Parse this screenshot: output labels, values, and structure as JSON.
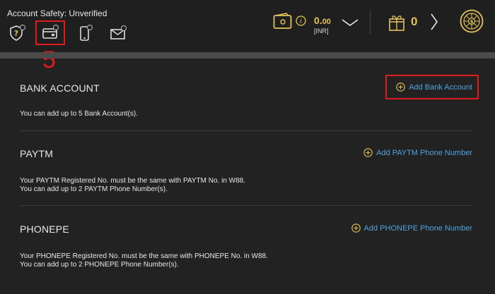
{
  "header": {
    "account_safety": "Account Safety: Unverified",
    "balance_main": "0.",
    "balance_decimals": "00",
    "currency": "[INR]",
    "gift_count": "0",
    "step_number": "5"
  },
  "icons": [
    "shield-question-icon",
    "card-icon",
    "phone-icon",
    "mail-icon",
    "wallet-icon",
    "info-icon",
    "chevron-down-icon",
    "gift-icon",
    "chevron-right-icon",
    "lucky-wheel-icon",
    "plus-circle-icon"
  ],
  "colors": {
    "accent_gold": "#e3c25a",
    "link_blue": "#4fa3e0",
    "highlight_red": "#e01b1b"
  },
  "sections": {
    "bank": {
      "title": "BANK ACCOUNT",
      "add_label": "Add Bank Account",
      "note1": "You can add up to 5 Bank Account(s)."
    },
    "paytm": {
      "title": "PAYTM",
      "add_label": "Add PAYTM Phone Number",
      "note1": "Your PAYTM Registered No. must be the same with PAYTM No. in W88.",
      "note2": "You can add up to 2 PAYTM Phone Number(s)."
    },
    "phonepe": {
      "title": "PHONEPE",
      "add_label": "Add PHONEPE Phone Number",
      "note1": "Your PHONEPE Registered No. must be the same with PHONEPE No. in W88.",
      "note2": "You can add up to 2 PHONEPE Phone Number(s)."
    }
  }
}
